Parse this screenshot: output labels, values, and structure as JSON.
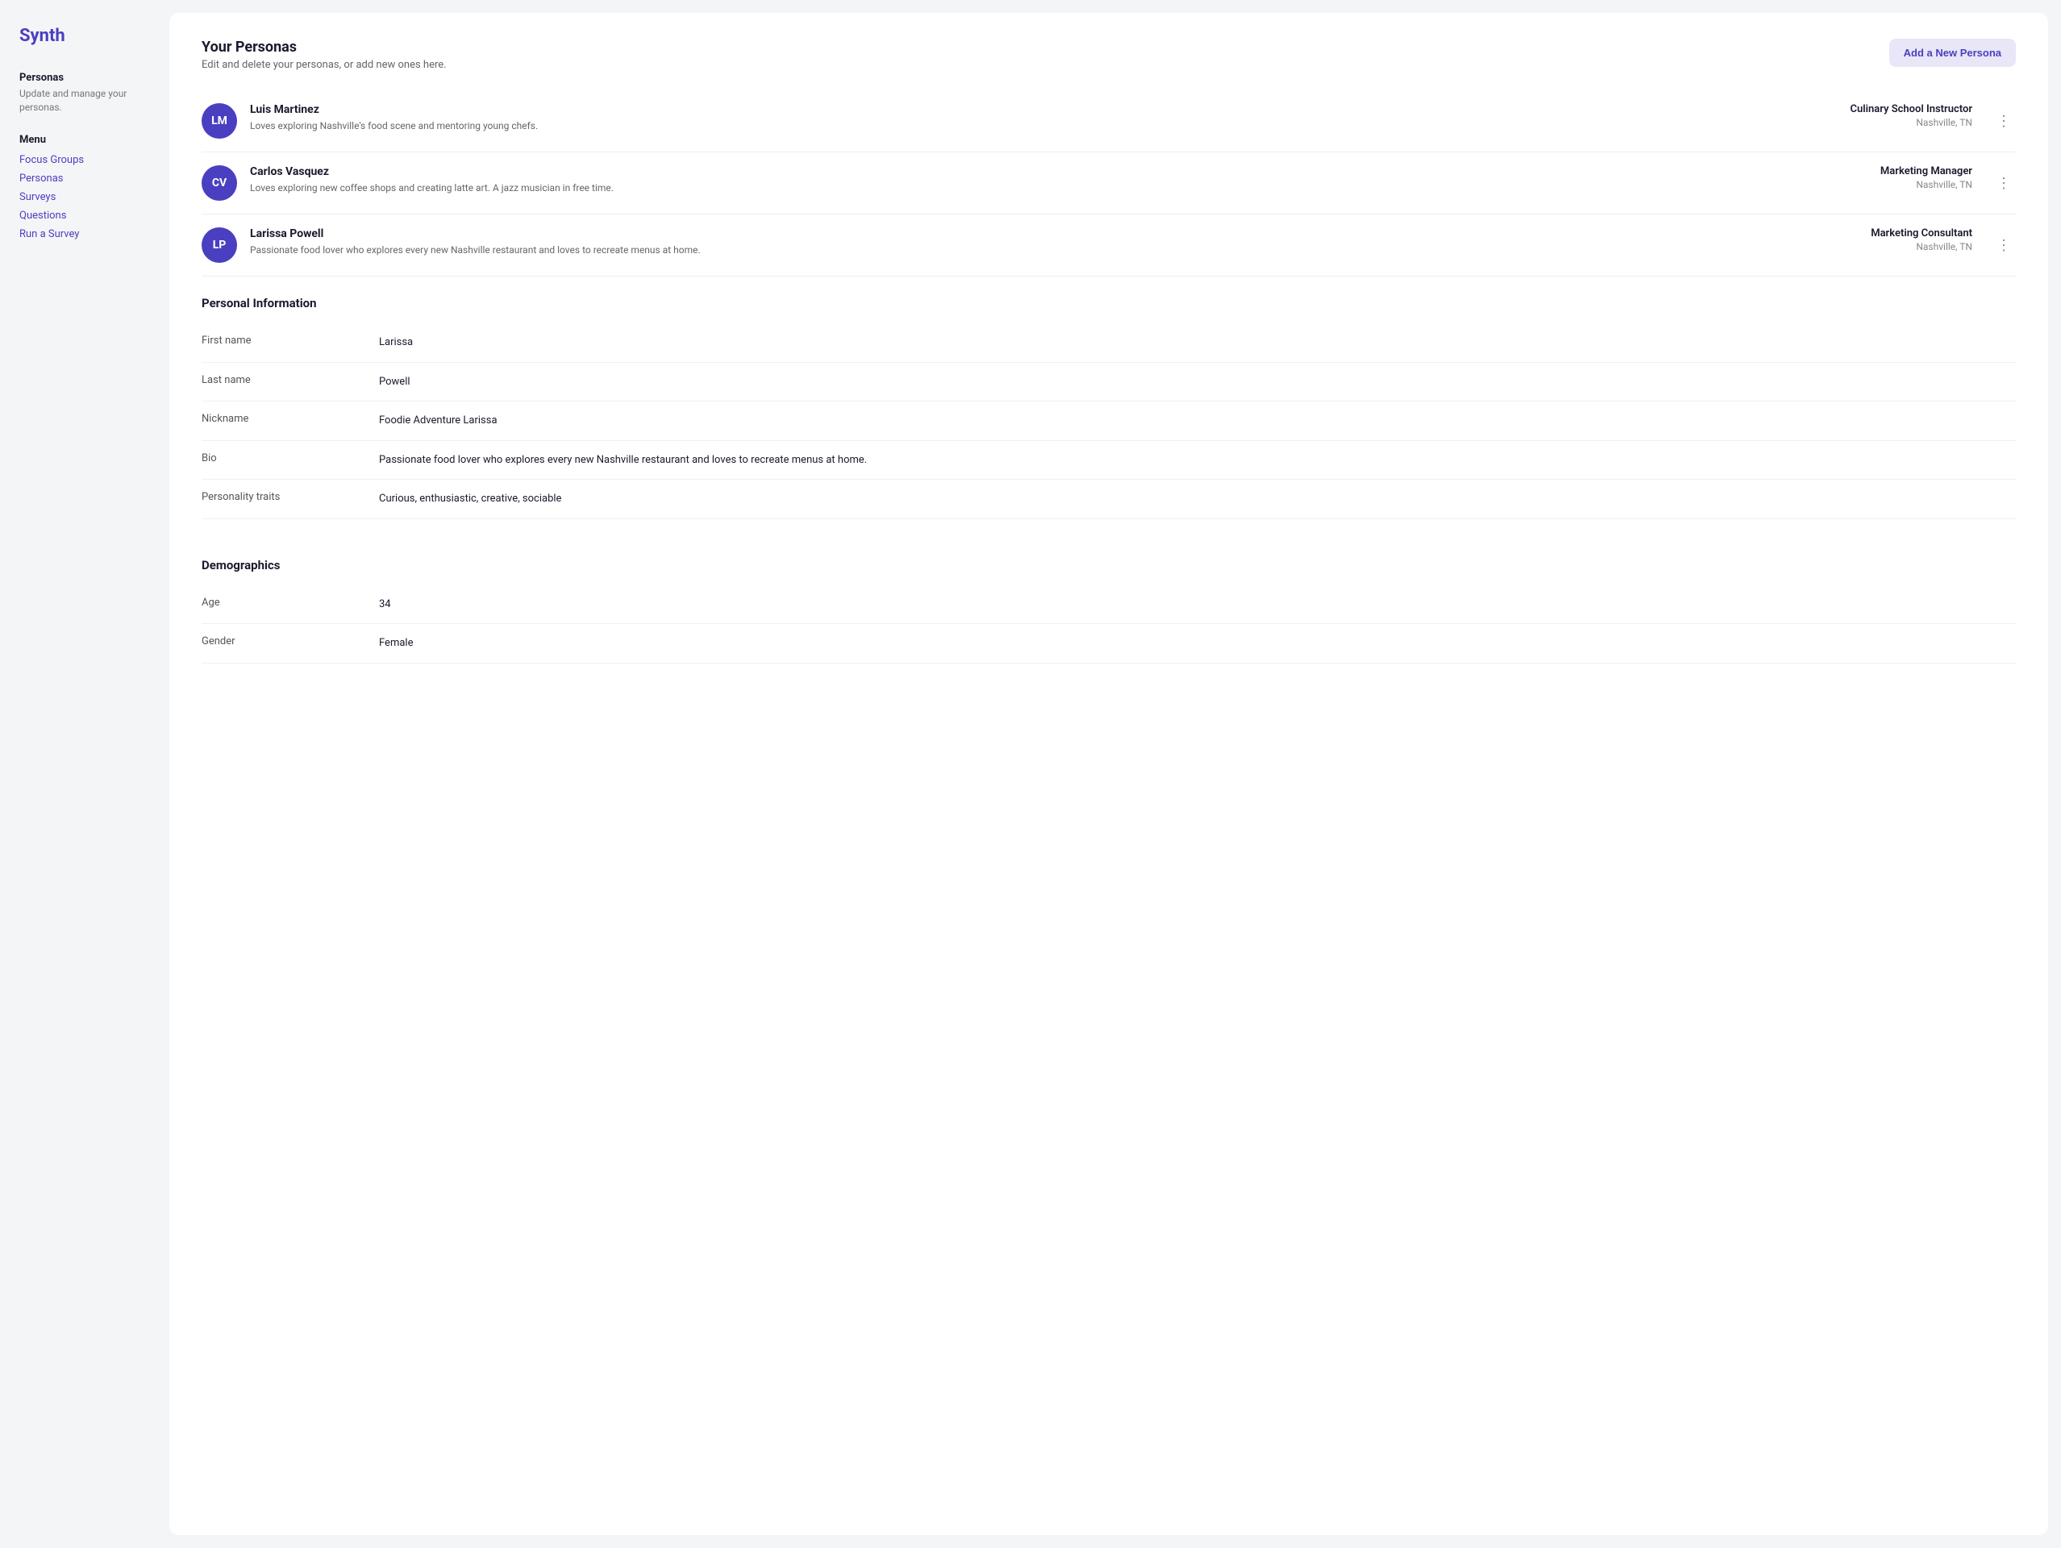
{
  "sidebar": {
    "logo": "Synth",
    "section_title": "Personas",
    "section_desc": "Update and manage your personas.",
    "menu_label": "Menu",
    "nav_items": [
      {
        "label": "Focus Groups",
        "href": "#"
      },
      {
        "label": "Personas",
        "href": "#"
      },
      {
        "label": "Surveys",
        "href": "#"
      },
      {
        "label": "Questions",
        "href": "#"
      },
      {
        "label": "Run a Survey",
        "href": "#"
      }
    ]
  },
  "page": {
    "title": "Your Personas",
    "subtitle": "Edit and delete your personas, or add new ones here.",
    "add_button": "Add a New Persona"
  },
  "personas": [
    {
      "initials": "LM",
      "name": "Luis Martinez",
      "bio": "Loves exploring Nashville's food scene and mentoring young chefs.",
      "role": "Culinary School Instructor",
      "location": "Nashville, TN"
    },
    {
      "initials": "CV",
      "name": "Carlos Vasquez",
      "bio": "Loves exploring new coffee shops and creating latte art. A jazz musician in free time.",
      "role": "Marketing Manager",
      "location": "Nashville, TN"
    },
    {
      "initials": "LP",
      "name": "Larissa Powell",
      "bio": "Passionate food lover who explores every new Nashville restaurant and loves to recreate menus at home.",
      "role": "Marketing Consultant",
      "location": "Nashville, TN"
    }
  ],
  "personal_info": {
    "section_title": "Personal Information",
    "fields": [
      {
        "label": "First name",
        "value": "Larissa"
      },
      {
        "label": "Last name",
        "value": "Powell"
      },
      {
        "label": "Nickname",
        "value": "Foodie Adventure Larissa"
      },
      {
        "label": "Bio",
        "value": "Passionate food lover who explores every new Nashville restaurant and loves to recreate menus at home."
      },
      {
        "label": "Personality traits",
        "value": "Curious, enthusiastic, creative, sociable"
      }
    ]
  },
  "demographics": {
    "section_title": "Demographics",
    "fields": [
      {
        "label": "Age",
        "value": "34"
      },
      {
        "label": "Gender",
        "value": "Female"
      }
    ]
  }
}
